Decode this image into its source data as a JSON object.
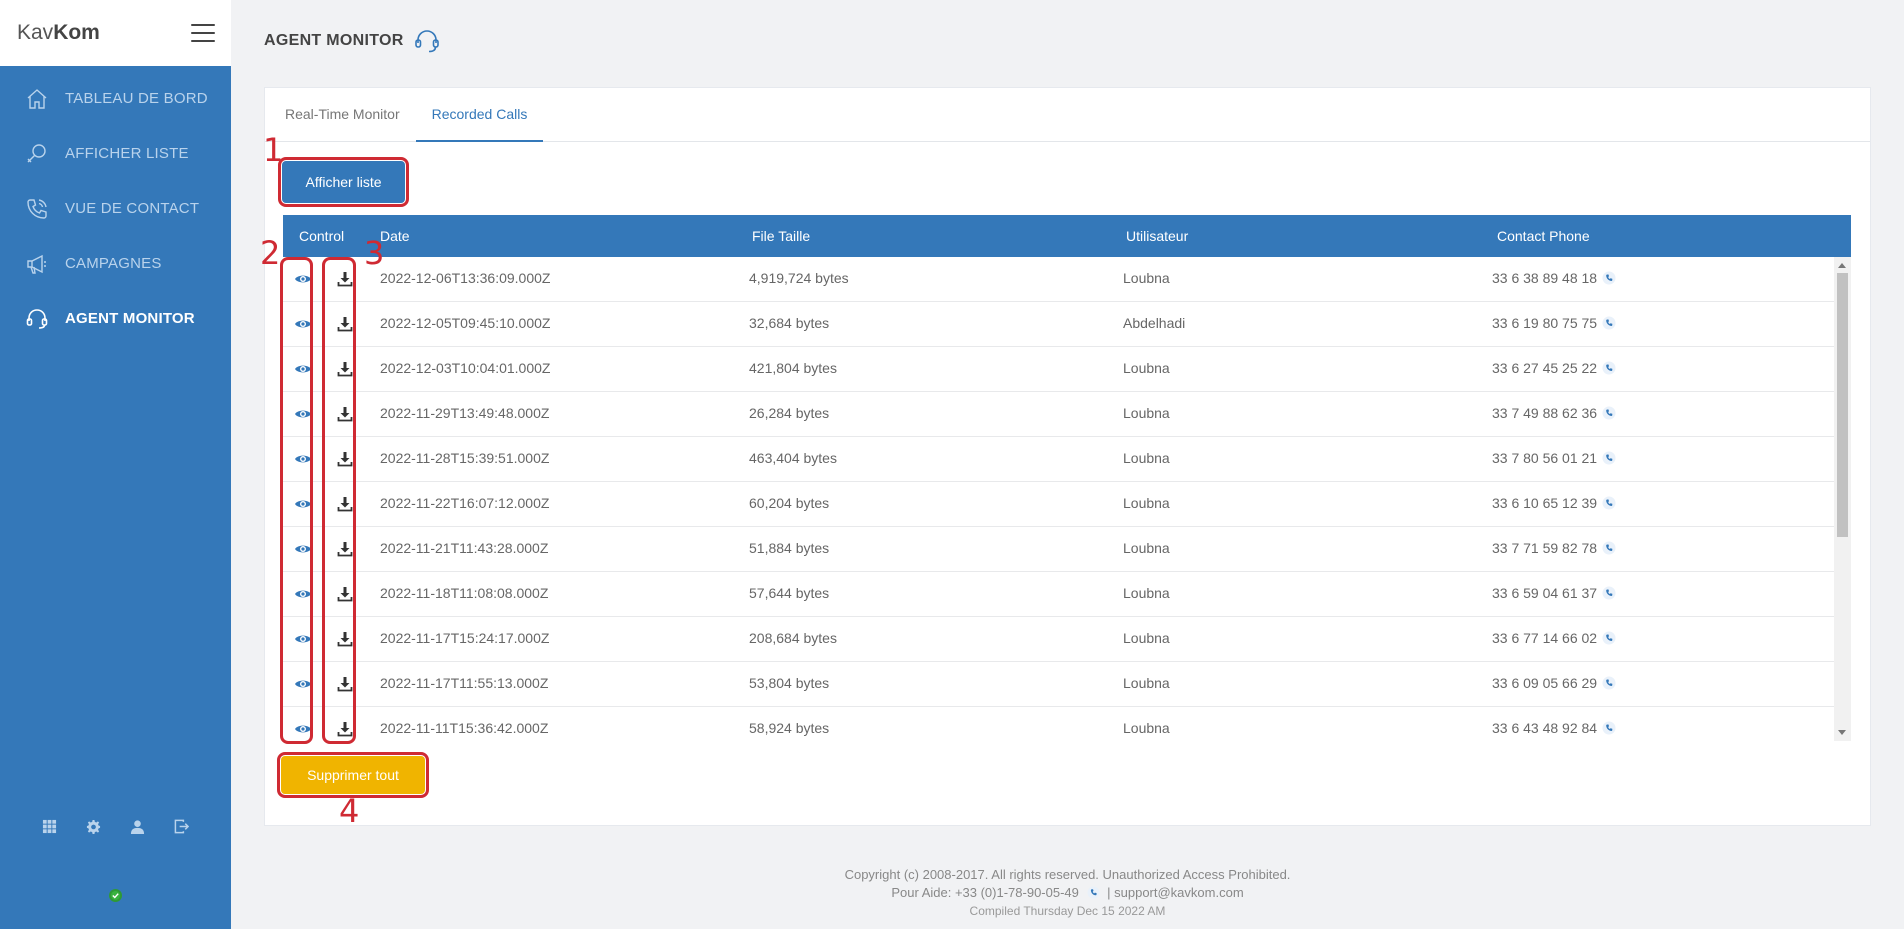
{
  "app": {
    "logo_light": "Kav",
    "logo_bold": "Kom"
  },
  "sidebar": {
    "items": [
      {
        "label": "TABLEAU DE BORD",
        "icon": "home-icon"
      },
      {
        "label": "AFFICHER LISTE",
        "icon": "search-list-icon"
      },
      {
        "label": "VUE DE CONTACT",
        "icon": "phone-icon"
      },
      {
        "label": "CAMPAGNES",
        "icon": "megaphone-icon"
      },
      {
        "label": "AGENT MONITOR",
        "icon": "headset-icon",
        "active": true
      }
    ],
    "tools": [
      "grid-icon",
      "gear-icon",
      "user-icon",
      "logout-icon"
    ],
    "status": "online"
  },
  "page": {
    "title": "AGENT MONITOR"
  },
  "tabs": [
    {
      "label": "Real-Time Monitor",
      "active": false
    },
    {
      "label": "Recorded Calls",
      "active": true
    }
  ],
  "buttons": {
    "list_label": "Afficher liste",
    "delete_label": "Supprimer tout"
  },
  "annotations": [
    "1",
    "2",
    "3",
    "4"
  ],
  "table": {
    "columns": [
      "Control",
      "Date",
      "File Taille",
      "Utilisateur",
      "Contact Phone"
    ],
    "rows": [
      {
        "date": "2022-12-06T13:36:09.000Z",
        "size": "4,919,724 bytes",
        "user": "Loubna",
        "phone": "33 6 38 89 48 18"
      },
      {
        "date": "2022-12-05T09:45:10.000Z",
        "size": "32,684 bytes",
        "user": "Abdelhadi",
        "phone": "33 6 19 80 75 75"
      },
      {
        "date": "2022-12-03T10:04:01.000Z",
        "size": "421,804 bytes",
        "user": "Loubna",
        "phone": "33 6 27 45 25 22"
      },
      {
        "date": "2022-11-29T13:49:48.000Z",
        "size": "26,284 bytes",
        "user": "Loubna",
        "phone": "33 7 49 88 62 36"
      },
      {
        "date": "2022-11-28T15:39:51.000Z",
        "size": "463,404 bytes",
        "user": "Loubna",
        "phone": "33 7 80 56 01 21"
      },
      {
        "date": "2022-11-22T16:07:12.000Z",
        "size": "60,204 bytes",
        "user": "Loubna",
        "phone": "33 6 10 65 12 39"
      },
      {
        "date": "2022-11-21T11:43:28.000Z",
        "size": "51,884 bytes",
        "user": "Loubna",
        "phone": "33 7 71 59 82 78"
      },
      {
        "date": "2022-11-18T11:08:08.000Z",
        "size": "57,644 bytes",
        "user": "Loubna",
        "phone": "33 6 59 04 61 37"
      },
      {
        "date": "2022-11-17T15:24:17.000Z",
        "size": "208,684 bytes",
        "user": "Loubna",
        "phone": "33 6 77 14 66 02"
      },
      {
        "date": "2022-11-17T11:55:13.000Z",
        "size": "53,804 bytes",
        "user": "Loubna",
        "phone": "33 6 09 05 66 29"
      },
      {
        "date": "2022-11-11T15:36:42.000Z",
        "size": "58,924 bytes",
        "user": "Loubna",
        "phone": "33 6 43 48 92 84"
      }
    ]
  },
  "footer": {
    "copyright": "Copyright (c) 2008-2017. All rights reserved. Unauthorized Access Prohibited.",
    "help_prefix": "Pour Aide: +33 (0)1-78-90-05-49",
    "help_suffix": "| support@kavkom.com",
    "compiled": "Compiled Thursday Dec 15 2022 AM"
  },
  "colors": {
    "brand": "#3478b9",
    "warning": "#f0b400",
    "annotation": "#cf2a33"
  }
}
